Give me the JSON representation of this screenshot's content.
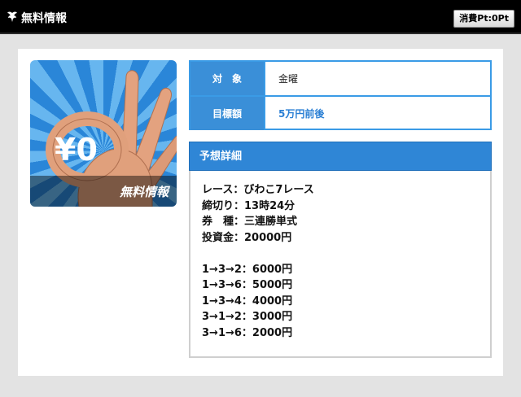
{
  "header": {
    "title": "無料情報",
    "points_button": "消費Pt:0Pt"
  },
  "card": {
    "banner_text": "無料情報",
    "price_text": "¥0"
  },
  "info": {
    "rows": [
      {
        "label": "対　象",
        "value": "金曜"
      },
      {
        "label": "目標額",
        "value": "5万円前後"
      }
    ]
  },
  "detail": {
    "heading": "予想詳細",
    "lines": [
      "レース：びわこ7レース",
      "締切り：13時24分",
      "券　種：三連勝単式",
      "投資金：20000円"
    ],
    "bets": [
      "1→3→2：6000円",
      "1→3→6：5000円",
      "1→3→4：4000円",
      "3→1→2：3000円",
      "3→1→6：2000円"
    ]
  },
  "colors": {
    "accent": "#2f86d6",
    "header_bg": "#000000",
    "page_bg": "#e3e3e3"
  }
}
